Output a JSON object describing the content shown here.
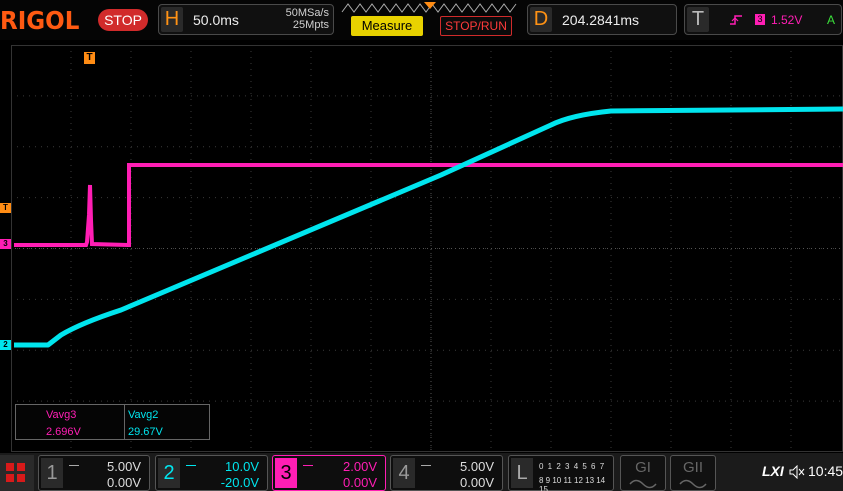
{
  "brand": "RIGOL",
  "run_state": "STOP",
  "horizontal": {
    "letter": "H",
    "timebase": "50.0ms",
    "sample_rate": "50MSa/s",
    "memory_depth": "25Mpts"
  },
  "buttons": {
    "measure": "Measure",
    "stop_run": "STOP/RUN"
  },
  "delay": {
    "letter": "D",
    "value": "204.2841ms"
  },
  "trigger": {
    "letter": "T",
    "source": "3",
    "level": "1.52V",
    "mode": "A"
  },
  "markers": {
    "trigger_position": "T",
    "trigger_level": "T",
    "ch3_ground": "3",
    "ch2_ground": "2"
  },
  "measurements": [
    {
      "name": "Vavg3",
      "value": "2.696V",
      "color": "#ff1eb4"
    },
    {
      "name": "Vavg2",
      "value": "29.67V",
      "color": "#00e5ee"
    }
  ],
  "channels": [
    {
      "num": "1",
      "scale": "5.00V",
      "offset": "0.00V",
      "color": "#e5e500",
      "active": false
    },
    {
      "num": "2",
      "scale": "10.0V",
      "offset": "-20.0V",
      "color": "#00e5ee",
      "active": true
    },
    {
      "num": "3",
      "scale": "2.00V",
      "offset": "0.00V",
      "color": "#ff1eb4",
      "active": true
    },
    {
      "num": "4",
      "scale": "5.00V",
      "offset": "0.00V",
      "color": "#3b7cff",
      "active": false
    }
  ],
  "logic": {
    "letter": "L",
    "row1": "0 1 2 3 4 5 6 7",
    "row2": "8 9 10 11 12 13 14 15"
  },
  "generators": [
    "GI",
    "GII"
  ],
  "status": {
    "lxi": "LXI",
    "time": "10:45"
  },
  "colors": {
    "ch2": "#00e5ee",
    "ch3": "#ff1eb4",
    "accent": "#ff8c14",
    "grid": "#3a3a3a"
  }
}
